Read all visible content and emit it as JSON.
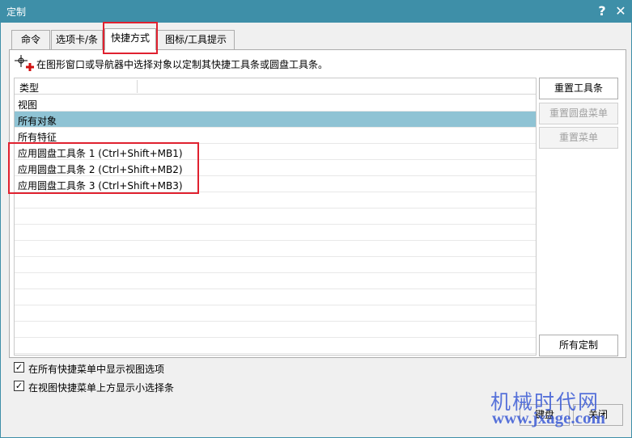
{
  "window": {
    "title": "定制",
    "help_label": "?",
    "close_label": "✕"
  },
  "tabs": [
    {
      "label": "命令",
      "active": false
    },
    {
      "label": "选项卡/条",
      "active": false
    },
    {
      "label": "快捷方式",
      "active": true
    },
    {
      "label": "图标/工具提示",
      "active": false
    }
  ],
  "instruction": "在图形窗口或导航器中选择对象以定制其快捷工具条或圆盘工具条。",
  "list": {
    "header": "类型",
    "items": [
      {
        "label": "视图",
        "selected": false
      },
      {
        "label": "所有对象",
        "selected": true
      },
      {
        "label": "所有特征",
        "selected": false
      },
      {
        "label": "应用圆盘工具条 1 (Ctrl+Shift+MB1)",
        "selected": false
      },
      {
        "label": "应用圆盘工具条 2 (Ctrl+Shift+MB2)",
        "selected": false
      },
      {
        "label": "应用圆盘工具条 3 (Ctrl+Shift+MB3)",
        "selected": false
      }
    ]
  },
  "side_buttons": {
    "reset_toolbar": "重置工具条",
    "reset_radial_menu": "重置圆盘菜单",
    "reset_menu": "重置菜单",
    "all_customizations": "所有定制"
  },
  "options": [
    {
      "label": "在所有快捷菜单中显示视图选项",
      "checked": true
    },
    {
      "label": "在视图快捷菜单上方显示小选择条",
      "checked": true
    }
  ],
  "footer": {
    "keyboard_label": "键盘",
    "close_label": "关闭"
  },
  "watermark": {
    "brand": "机械时代网",
    "url": "www.jxage.com"
  },
  "colors": {
    "titlebar": "#3e8fa8",
    "selection": "#8fc3d4",
    "highlight_box": "#e0212f",
    "watermark": "#3c5bd6"
  }
}
